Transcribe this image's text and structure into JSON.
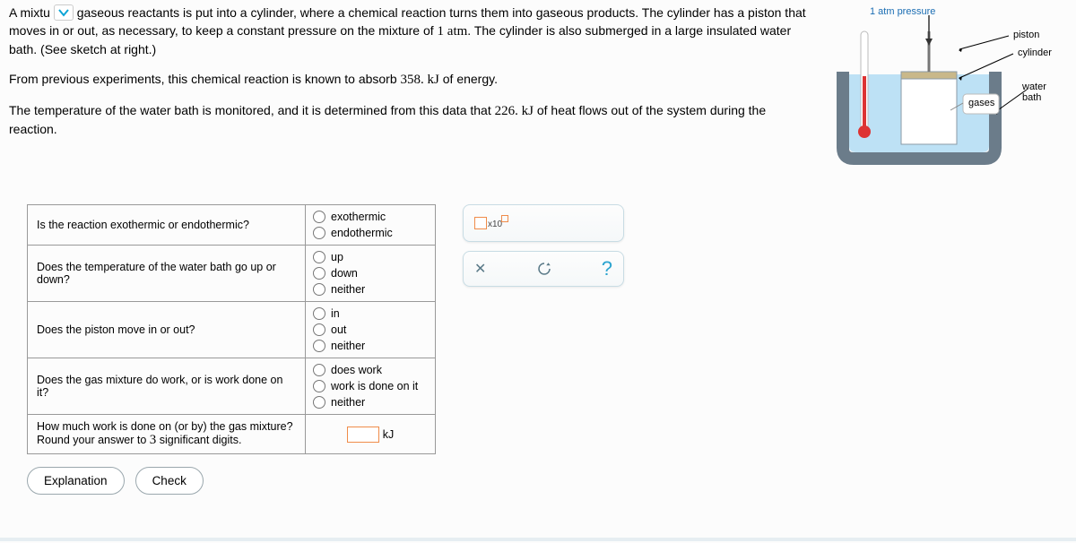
{
  "problem": {
    "p1_a": "A mixtu",
    "p1_b": "gaseous reactants is put into a cylinder, where a chemical reaction turns them into gaseous products. The cylinder has a piston that moves in or out, as necessary, to keep a constant pressure on the mixture of ",
    "p1_atm": "1 atm",
    "p1_c": ". The cylinder is also submerged in a large insulated water bath. (See sketch at right.)",
    "p2_a": "From previous experiments, this chemical reaction is known to absorb ",
    "p2_energy": "358. kJ",
    "p2_b": " of energy.",
    "p3_a": "The temperature of the water bath is monitored, and it is determined from this data that ",
    "p3_heat": "226. kJ",
    "p3_b": " of heat flows out of the system during the reaction."
  },
  "sketch": {
    "pressure": "1 atm pressure",
    "piston": "piston",
    "cylinder": "cylinder",
    "waterbath": "water bath",
    "gases": "gases"
  },
  "questions": {
    "q1": "Is the reaction exothermic or endothermic?",
    "q1_opts": {
      "a": "exothermic",
      "b": "endothermic"
    },
    "q2": "Does the temperature of the water bath go up or down?",
    "q2_opts": {
      "a": "up",
      "b": "down",
      "c": "neither"
    },
    "q3": "Does the piston move in or out?",
    "q3_opts": {
      "a": "in",
      "b": "out",
      "c": "neither"
    },
    "q4": "Does the gas mixture do work, or is work done on it?",
    "q4_opts": {
      "a": "does work",
      "b": "work is done on it",
      "c": "neither"
    },
    "q5_a": "How much work is done on (or by) the gas mixture? Round your answer to ",
    "q5_sig": "3",
    "q5_b": " significant digits.",
    "q5_unit": "kJ"
  },
  "toolbar": {
    "x10": "x10",
    "close": "✕",
    "redo": "↺",
    "help": "?"
  },
  "buttons": {
    "explanation": "Explanation",
    "check": "Check"
  }
}
